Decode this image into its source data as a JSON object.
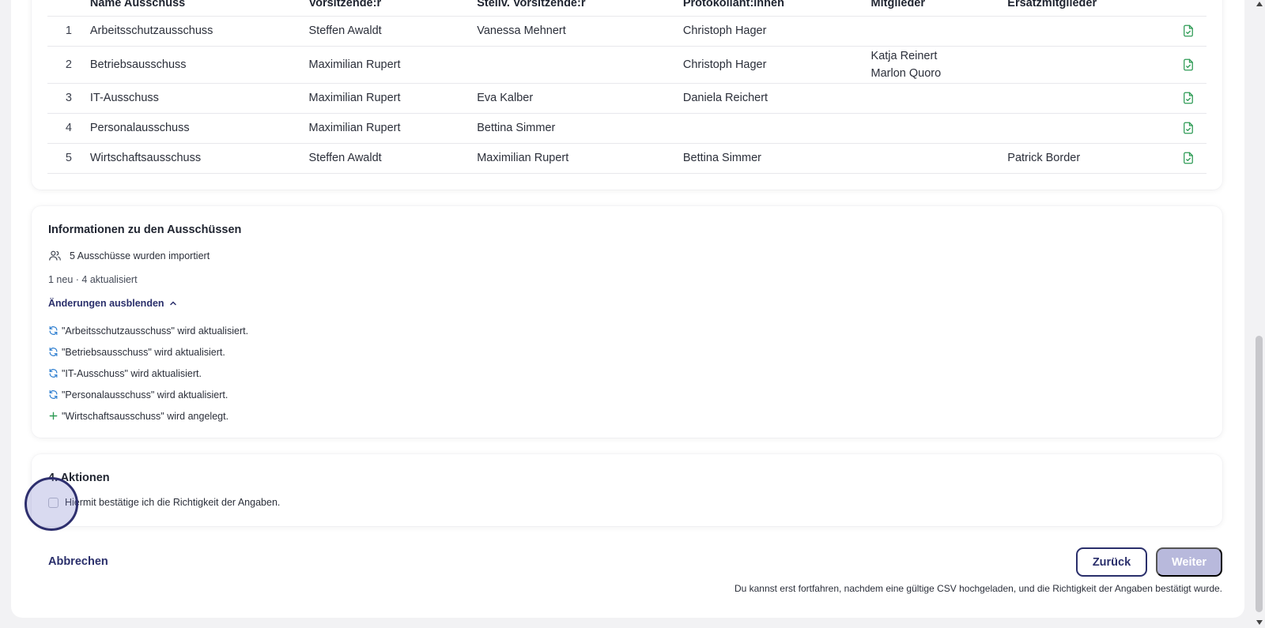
{
  "table": {
    "headers": [
      "",
      "Name Ausschuss",
      "Vorsitzende:r",
      "Stellv. Vorsitzende:r",
      "Protokollant:innen",
      "Mitglieder",
      "Ersatzmitglieder",
      ""
    ],
    "rows": [
      {
        "index": "1",
        "name": "Arbeitsschutzausschuss",
        "vorsitz": "Steffen Awaldt",
        "stellv": "Vanessa Mehnert",
        "protokoll": "Christoph Hager",
        "mitglieder": [],
        "ersatz": ""
      },
      {
        "index": "2",
        "name": "Betriebsausschuss",
        "vorsitz": "Maximilian Rupert",
        "stellv": "",
        "protokoll": "Christoph Hager",
        "mitglieder": [
          "Katja Reinert",
          "Marlon Quoro"
        ],
        "ersatz": ""
      },
      {
        "index": "3",
        "name": "IT-Ausschuss",
        "vorsitz": "Maximilian Rupert",
        "stellv": "Eva Kalber",
        "protokoll": "Daniela Reichert",
        "mitglieder": [],
        "ersatz": ""
      },
      {
        "index": "4",
        "name": "Personalausschuss",
        "vorsitz": "Maximilian Rupert",
        "stellv": "Bettina Simmer",
        "protokoll": "",
        "mitglieder": [],
        "ersatz": ""
      },
      {
        "index": "5",
        "name": "Wirtschaftsausschuss",
        "vorsitz": "Steffen Awaldt",
        "stellv": "Maximilian Rupert",
        "protokoll": "Bettina Simmer",
        "mitglieder": [],
        "ersatz": "Patrick Border"
      }
    ],
    "row_icon": "file-check-icon"
  },
  "info": {
    "title": "Informationen zu den Ausschüssen",
    "imported": "5 Ausschüsse wurden importiert",
    "summary": "1 neu · 4 aktualisiert",
    "toggle_label": "Änderungen ausblenden",
    "changes": [
      {
        "type": "update",
        "icon": "refresh-icon",
        "text": "\"Arbeitsschutzausschuss\" wird aktualisiert."
      },
      {
        "type": "update",
        "icon": "refresh-icon",
        "text": "\"Betriebsausschuss\" wird aktualisiert."
      },
      {
        "type": "update",
        "icon": "refresh-icon",
        "text": "\"IT-Ausschuss\" wird aktualisiert."
      },
      {
        "type": "update",
        "icon": "refresh-icon",
        "text": "\"Personalausschuss\" wird aktualisiert."
      },
      {
        "type": "create",
        "icon": "plus-icon",
        "text": "\"Wirtschaftsausschuss\" wird angelegt."
      }
    ]
  },
  "actions": {
    "title": "4. Aktionen",
    "confirm_label": "Hiermit bestätige ich die Richtigkeit der Angaben.",
    "confirm_checked": false
  },
  "footer": {
    "cancel_label": "Abbrechen",
    "back_label": "Zurück",
    "next_label": "Weiter",
    "hint": "Du kannst erst fortfahren, nachdem eine gültige CSV hochgeladen, und die Richtigkeit der Angaben bestätigt wurde."
  },
  "colors": {
    "accent": "#2a2f6b",
    "disabled_button": "#b8b9dc",
    "success_icon": "#2e9b55",
    "update_icon": "#2f7fd0"
  }
}
